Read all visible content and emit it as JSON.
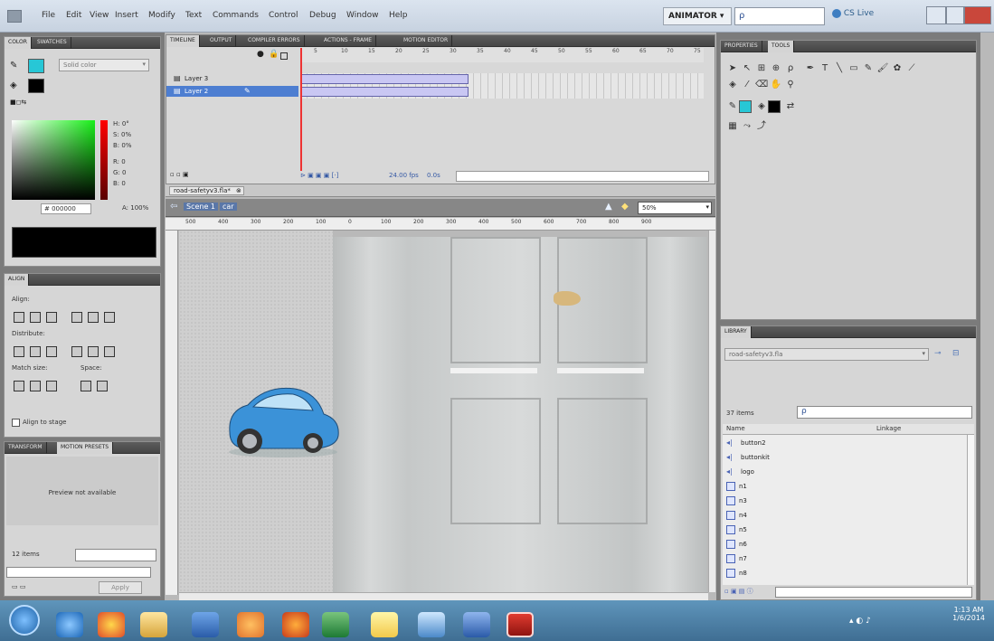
{
  "menubar": {
    "items": [
      "File",
      "Edit",
      "View",
      "Insert",
      "Modify",
      "Text",
      "Commands",
      "Control",
      "Debug",
      "Window",
      "Help"
    ],
    "workspace": "ANIMATOR ▾",
    "search_placeholder": "ρ",
    "cslive": "CS Live"
  },
  "color_panel": {
    "tabs": [
      "COLOR",
      "SWATCHES"
    ],
    "fill_type": "Solid color",
    "hsv": [
      "H: 0°",
      "S: 0%",
      "B: 0%"
    ],
    "rgb": [
      "R: 0",
      "G: 0",
      "B: 0"
    ],
    "hex": "000000",
    "alpha": "A: 100%"
  },
  "align_panel": {
    "title": "ALIGN",
    "align": "Align:",
    "distribute": "Distribute:",
    "match_size": "Match size:",
    "space": "Space:",
    "align_to_stage": "Align to stage"
  },
  "bottom_left_panel": {
    "tabs": [
      "TRANSFORM",
      "MOTION PRESETS"
    ],
    "preview": "Preview not available",
    "items": "12 items",
    "apply": "Apply"
  },
  "timeline": {
    "tabs": [
      "TIMELINE",
      "OUTPUT",
      "COMPILER ERRORS",
      "ACTIONS - FRAME",
      "MOTION EDITOR"
    ],
    "frame_numbers": [
      "5",
      "10",
      "15",
      "20",
      "25",
      "30",
      "35",
      "40",
      "45",
      "50",
      "55",
      "60",
      "65",
      "70",
      "75"
    ],
    "layers": [
      "Layer 3",
      "Layer 2"
    ],
    "fps": "24.00 fps",
    "time": "0.0s"
  },
  "document": {
    "tab": "road-safetyv3.fla*",
    "scene": "Scene 1",
    "symbol": "car",
    "zoom": "50%",
    "ruler": [
      "500",
      "400",
      "300",
      "200",
      "100",
      "0",
      "100",
      "200",
      "300",
      "400",
      "500",
      "600",
      "700",
      "800",
      "900"
    ]
  },
  "right_top_panel": {
    "tabs": [
      "PROPERTIES",
      "TOOLS"
    ]
  },
  "library": {
    "title": "LIBRARY",
    "file": "road-safetyv3.fla",
    "count": "37 items",
    "name_header": "Name",
    "linkage_header": "Linkage",
    "items": [
      "button2",
      "buttonkit",
      "logo",
      "n1",
      "n3",
      "n4",
      "n5",
      "n6",
      "n7",
      "n8"
    ]
  },
  "taskbar": {
    "time": "1:13 AM",
    "date": "1/6/2014"
  }
}
